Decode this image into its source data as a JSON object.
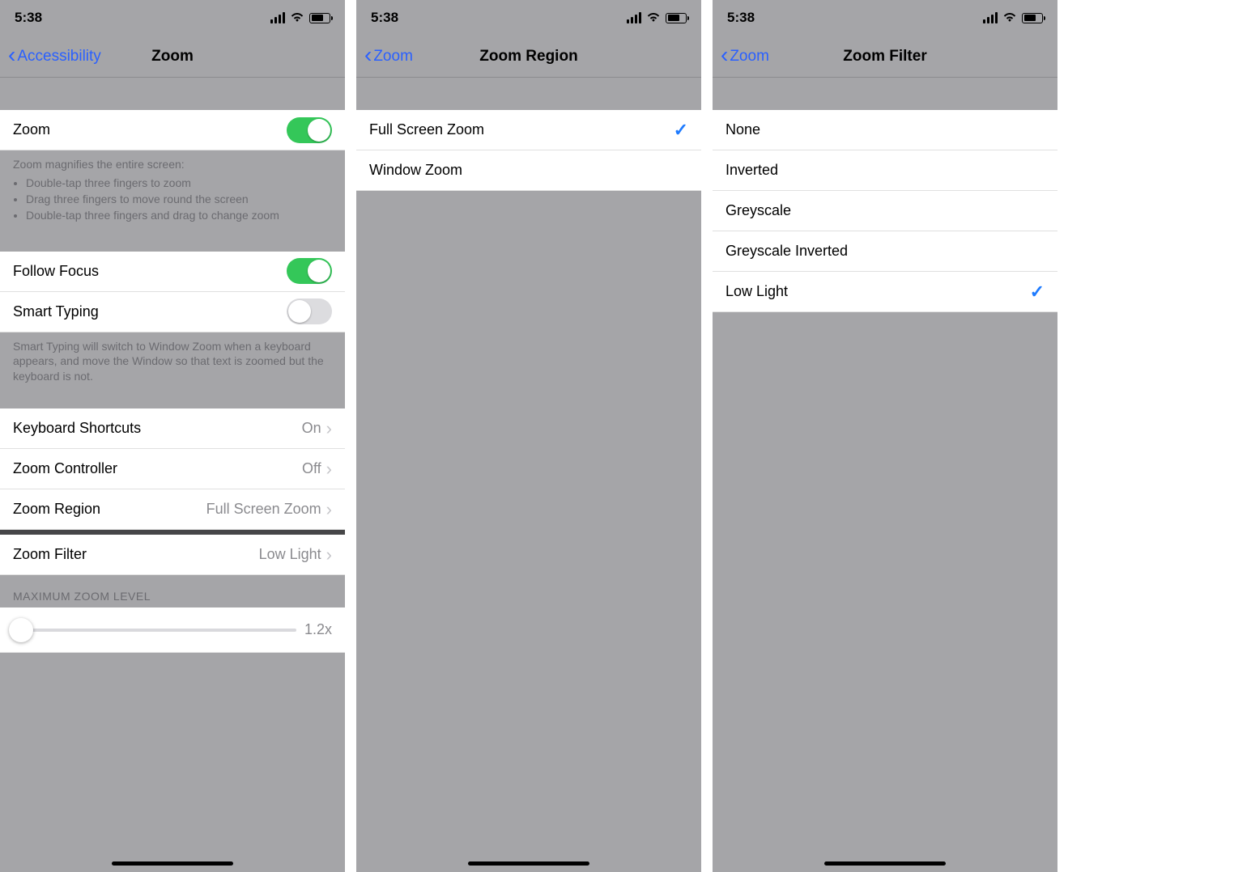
{
  "status": {
    "time": "5:38"
  },
  "screen1": {
    "back": "Accessibility",
    "title": "Zoom",
    "zoom": {
      "label": "Zoom",
      "on": true
    },
    "zoom_desc_head": "Zoom magnifies the entire screen:",
    "zoom_desc_items": [
      "Double-tap three fingers to zoom",
      "Drag three fingers to move round the screen",
      "Double-tap three fingers and drag to change zoom"
    ],
    "follow_focus": {
      "label": "Follow Focus",
      "on": true
    },
    "smart_typing": {
      "label": "Smart Typing",
      "on": false
    },
    "smart_typing_desc": "Smart Typing will switch to Window Zoom when a keyboard appears, and move the Window so that text is zoomed but the keyboard is not.",
    "keyboard_shortcuts": {
      "label": "Keyboard Shortcuts",
      "value": "On"
    },
    "zoom_controller": {
      "label": "Zoom Controller",
      "value": "Off"
    },
    "zoom_region": {
      "label": "Zoom Region",
      "value": "Full Screen Zoom"
    },
    "zoom_filter": {
      "label": "Zoom Filter",
      "value": "Low Light"
    },
    "max_zoom_header": "MAXIMUM ZOOM LEVEL",
    "max_zoom_value": "1.2x"
  },
  "screen2": {
    "back": "Zoom",
    "title": "Zoom Region",
    "options": [
      {
        "label": "Full Screen Zoom",
        "selected": true
      },
      {
        "label": "Window Zoom",
        "selected": false
      }
    ]
  },
  "screen3": {
    "back": "Zoom",
    "title": "Zoom Filter",
    "options": [
      {
        "label": "None",
        "selected": false
      },
      {
        "label": "Inverted",
        "selected": false
      },
      {
        "label": "Greyscale",
        "selected": false
      },
      {
        "label": "Greyscale Inverted",
        "selected": false
      },
      {
        "label": "Low Light",
        "selected": true
      }
    ]
  }
}
